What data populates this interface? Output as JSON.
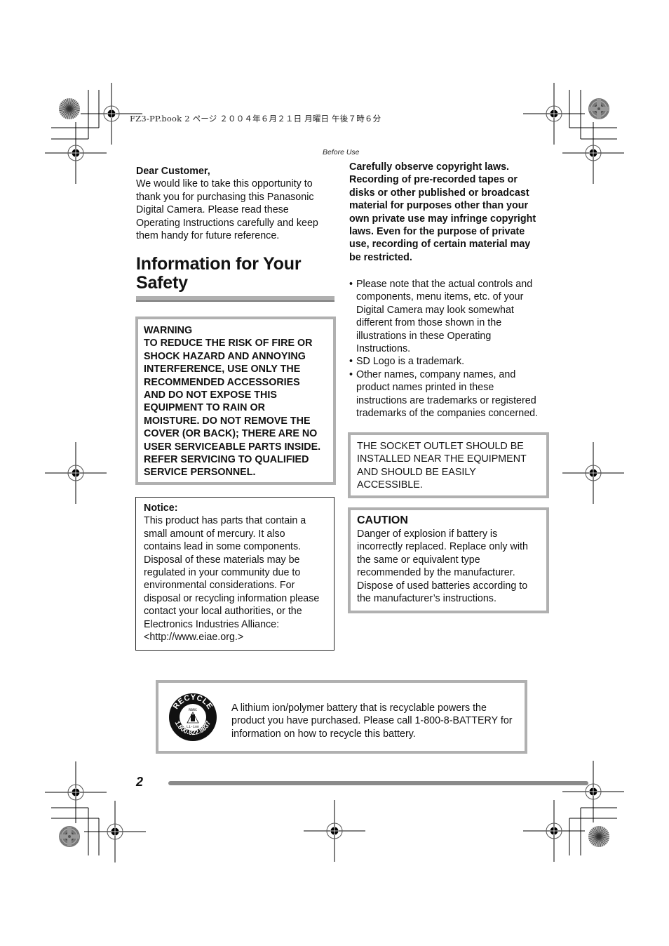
{
  "print_header": {
    "text": "FZ3-PP.book  2 ページ  ２００４年６月２１日  月曜日  午後７時６分"
  },
  "section_label": "Before Use",
  "greeting": {
    "heading": "Dear Customer,",
    "lines": [
      "We would like to take this opportunity to",
      "thank you for purchasing this Panasonic",
      "Digital Camera. Please read these",
      "Operating Instructions carefully and keep",
      "them handy for future reference."
    ]
  },
  "page_title": {
    "line1": "Information for Your",
    "line2": "Safety"
  },
  "warning_box": {
    "lines": [
      "WARNING",
      "TO REDUCE THE RISK OF FIRE OR",
      "SHOCK HAZARD AND ANNOYING",
      "INTERFERENCE, USE ONLY THE",
      "RECOMMENDED ACCESSORIES",
      "AND DO NOT EXPOSE THIS",
      "EQUIPMENT TO RAIN OR",
      "MOISTURE. DO NOT REMOVE THE",
      "COVER (OR BACK); THERE ARE NO",
      "USER SERVICEABLE PARTS INSIDE.",
      "REFER SERVICING TO QUALIFIED",
      "SERVICE PERSONNEL."
    ]
  },
  "notice_box": {
    "heading": "Notice:",
    "lines": [
      "This product has parts that contain a",
      "small amount of mercury. It also",
      "contains lead in some components.",
      "Disposal of these materials may be",
      "regulated in your community due to",
      "environmental considerations. For",
      "disposal or recycling information please",
      "contact your local authorities, or the",
      "Electronics Industries Alliance:",
      "<http://www.eiae.org.>"
    ]
  },
  "copyright_notice": {
    "lines": [
      "Carefully observe copyright laws.",
      "Recording of pre-recorded tapes or",
      "disks or other published or broadcast",
      "material for purposes other than your",
      "own private use may infringe copyright",
      "laws. Even for the purpose of private",
      "use, recording of certain material may",
      "be restricted."
    ]
  },
  "bullets": [
    {
      "bullet": "•",
      "lines": [
        "Please note that the actual controls and",
        "components, menu items, etc. of your",
        "Digital Camera may look somewhat",
        "different from those shown in the",
        "illustrations in these Operating",
        "Instructions."
      ]
    },
    {
      "bullet": "•",
      "lines": [
        "SD Logo is a trademark."
      ]
    },
    {
      "bullet": "•",
      "lines": [
        "Other names, company names, and",
        "product names printed in these",
        "instructions are trademarks or registered",
        "trademarks of the companies concerned."
      ]
    }
  ],
  "socket_box": {
    "lines": [
      "THE SOCKET OUTLET SHOULD BE",
      "INSTALLED NEAR THE EQUIPMENT",
      "AND SHOULD BE EASILY",
      "ACCESSIBLE."
    ]
  },
  "caution_box": {
    "heading": "CAUTION",
    "lines": [
      "Danger of explosion if battery is",
      "incorrectly replaced. Replace only with",
      "the same or equivalent type",
      "recommended by the manufacturer.",
      "Dispose of used batteries according to",
      "the manufacturer’s instructions."
    ]
  },
  "recycle_box": {
    "logo": {
      "icon": "rbrc-recycle-seal-icon",
      "top_text": "RECYCLE",
      "bottom_text": "1.800.822.8837",
      "inner_top": "RBRC",
      "inner_bottom": "Li-ion"
    },
    "lines": [
      "A lithium ion/polymer battery that is recyclable powers the",
      "product you have purchased. Please call 1-800-8-BATTERY for",
      "information on how to recycle this battery."
    ]
  },
  "page_number": "2",
  "colors": {
    "box_border_gray": "#b0b0b0",
    "rule_gray": "#8a8a8a",
    "text": "#111111"
  },
  "print_marks": {
    "registration_mark_icon": "crosshair-target-icon",
    "color_bar_icon": "starburst-circle-icon"
  }
}
